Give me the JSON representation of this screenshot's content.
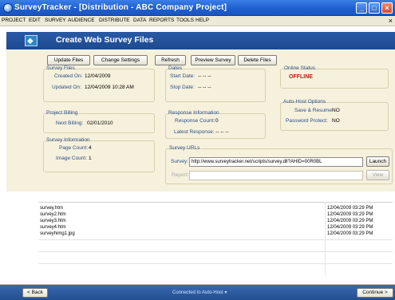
{
  "window": {
    "title": "SurveyTracker - [Distribution - ABC Company Project]",
    "minimize_glyph": "_",
    "maximize_glyph": "□",
    "close_glyph": "×"
  },
  "menu": {
    "items": [
      "PROJECT",
      "EDIT",
      "SURVEY",
      "AUDIENCE",
      "DISTRIBUTE",
      "DATA",
      "REPORTS",
      "TOOLS",
      "HELP"
    ],
    "close_glyph": "×"
  },
  "header": {
    "title": "Create Web Survey Files",
    "icon_glyph": "◆"
  },
  "toolbar": {
    "update_files": "Update Files",
    "change_settings": "Change Settings",
    "refresh": "Refresh",
    "preview_survey": "Preview Survey",
    "delete_files": "Delete Files"
  },
  "survey_files": {
    "title": "Survey Files",
    "created_label": "Created On:",
    "created_value": "12/04/2009",
    "updated_label": "Updated On:",
    "updated_value": "12/04/2009 10:28 AM"
  },
  "dates": {
    "title": "Dates",
    "start_label": "Start Date:",
    "start_value": "-- -- --",
    "stop_label": "Stop Date:",
    "stop_value": "-- -- --"
  },
  "online_status": {
    "title": "Online Status",
    "value": "OFFLINE"
  },
  "project_billing": {
    "title": "Project Billing",
    "next_label": "Next Billing:",
    "next_value": "02/01/2010"
  },
  "response_info": {
    "title": "Response Information",
    "count_label": "Response Count:",
    "count_value": "0",
    "latest_label": "Latest Response:",
    "latest_value": "-- -- --"
  },
  "auto_host": {
    "title": "Auto-Host Options",
    "save_label": "Save & Resume:",
    "save_value": "NO",
    "password_label": "Password Protect:",
    "password_value": "NO"
  },
  "survey_info": {
    "title": "Survey Information",
    "page_label": "Page Count:",
    "page_value": "4",
    "image_label": "Image Count:",
    "image_value": "1"
  },
  "survey_urls": {
    "title": "Survey URLs",
    "survey_label": "Survey:",
    "survey_value": "http://www.surveytracker.net/scripts/survey.dll?AHID=00R0BL",
    "launch_label": "Launch",
    "report_label": "Report:",
    "report_value": "",
    "view_label": "View"
  },
  "files": [
    {
      "name": "survey.htm",
      "date": "12/04/2009 03:29 PM"
    },
    {
      "name": "survey2.htm",
      "date": "12/04/2009 03:29 PM"
    },
    {
      "name": "survey3.htm",
      "date": "12/04/2009 03:29 PM"
    },
    {
      "name": "survey4.htm",
      "date": "12/04/2009 03:29 PM"
    },
    {
      "name": "surveyhimg1.jpg",
      "date": "12/04/2009 03:29 PM"
    }
  ],
  "bottom": {
    "back_label": "< Back",
    "status": "Connected to Auto-Host",
    "status_arrow": "▾",
    "continue_label": "Continue >"
  }
}
